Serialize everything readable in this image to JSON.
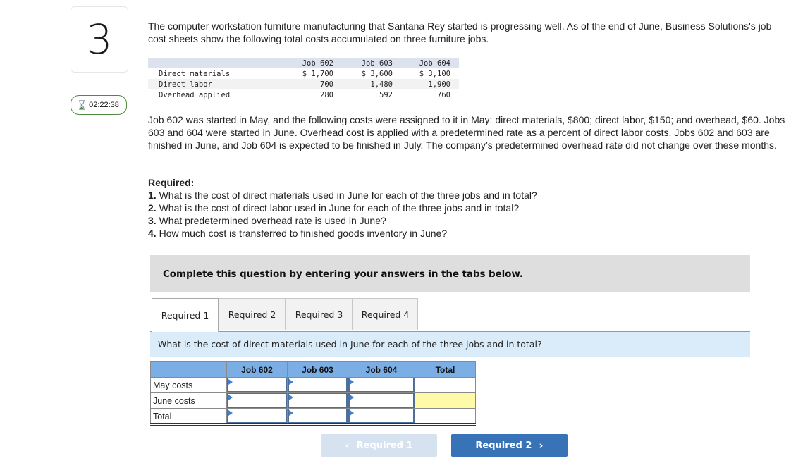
{
  "question": {
    "number": "3",
    "timer": "02:22:38"
  },
  "intro_text": "The computer workstation furniture manufacturing that Santana Rey started is progressing well. As of the end of June, Business Solutions's job cost sheets show the following total costs accumulated on three furniture jobs.",
  "cost_table": {
    "headers": [
      "",
      "Job 602",
      "Job 603",
      "Job 604"
    ],
    "rows": [
      {
        "label": "Direct materials",
        "values": [
          "$ 1,700",
          "$ 3,600",
          "$ 3,100"
        ]
      },
      {
        "label": "Direct labor",
        "values": [
          "700",
          "1,480",
          "1,900"
        ]
      },
      {
        "label": "Overhead applied",
        "values": [
          "280",
          "592",
          "760"
        ]
      }
    ]
  },
  "job_info_text": "Job 602 was started in May, and the following costs were assigned to it in May: direct materials, $800; direct labor, $150; and overhead, $60. Jobs 603 and 604 were started in June. Overhead cost is applied with a predetermined rate as a percent of direct labor costs. Jobs 602 and 603 are finished in June, and Job 604 is expected to be finished in July. The company’s predetermined overhead rate did not change over these months.",
  "required": {
    "heading": "Required:",
    "items": [
      {
        "num": "1.",
        "text": " What is the cost of direct materials used in June for each of the three jobs and in total?"
      },
      {
        "num": "2.",
        "text": " What is the cost of direct labor used in June for each of the three jobs and in total?"
      },
      {
        "num": "3.",
        "text": " What predetermined overhead rate is used in June?"
      },
      {
        "num": "4.",
        "text": " How much cost is transferred to finished goods inventory in June?"
      }
    ]
  },
  "instruction": "Complete this question by entering your answers in the tabs below.",
  "tabs": [
    {
      "label": "Required 1",
      "active": true
    },
    {
      "label": "Required 2",
      "active": false
    },
    {
      "label": "Required 3",
      "active": false
    },
    {
      "label": "Required 4",
      "active": false
    }
  ],
  "active_question": "What is the cost of direct materials used in June for each of the three jobs and in total?",
  "answer_table": {
    "headers": [
      "",
      "Job 602",
      "Job 603",
      "Job 604",
      "Total"
    ],
    "rows": [
      {
        "label": "May costs",
        "values": [
          "",
          "",
          "",
          ""
        ]
      },
      {
        "label": "June costs",
        "values": [
          "",
          "",
          "",
          ""
        ]
      },
      {
        "label": "Total",
        "values": [
          "",
          "",
          "",
          ""
        ]
      }
    ]
  },
  "nav": {
    "prev_label": "Required 1",
    "next_label": "Required 2",
    "prev_chevron": "‹",
    "next_chevron": "›"
  },
  "colors": {
    "header_blue": "#7aaee4",
    "highlight_yellow": "#fffaa8",
    "next_button": "#3873b8",
    "prev_button_disabled": "#d7e2f0",
    "timer_border": "#4d8a3f"
  }
}
